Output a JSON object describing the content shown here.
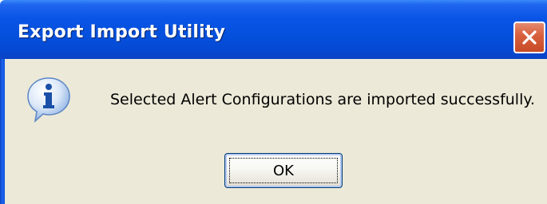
{
  "window": {
    "title": "Export Import Utility",
    "close_icon": "close-x-icon"
  },
  "dialog": {
    "icon": "information-icon",
    "message": "Selected Alert Configurations are imported successfully.",
    "ok_label": "OK"
  },
  "colors": {
    "titlebar": "#0550dc",
    "client_background": "#ece9d8",
    "close_button": "#d9623f",
    "text": "#000000"
  }
}
